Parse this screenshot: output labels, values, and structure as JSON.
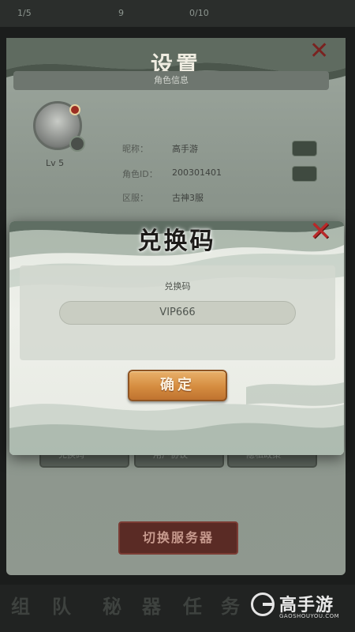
{
  "status_bar": {
    "resources": [
      "1/5",
      "9",
      "0/10"
    ]
  },
  "settings": {
    "title": "设置",
    "info_header": "角色信息",
    "level": "Lv 5",
    "rows": [
      {
        "label": "昵称：",
        "value": "高手游"
      },
      {
        "label": "角色ID：",
        "value": "200301401"
      },
      {
        "label": "区服：",
        "value": "古神3服"
      }
    ],
    "mid_buttons": [
      "兑换码",
      "用户协议",
      "隐私政策"
    ],
    "switch_server_label": "切换服务器",
    "bottom_chars": [
      "组",
      "队",
      "秘",
      "器",
      "任",
      "务"
    ]
  },
  "modal": {
    "title": "兑换码",
    "field_label": "兑换码",
    "code_value": "VIP666",
    "confirm_label": "确定"
  },
  "watermark": {
    "name": "高手游",
    "site": "GAOSHOUYOU.COM"
  },
  "colors": {
    "close": "#b9292a",
    "confirm": "#d58c3f"
  }
}
